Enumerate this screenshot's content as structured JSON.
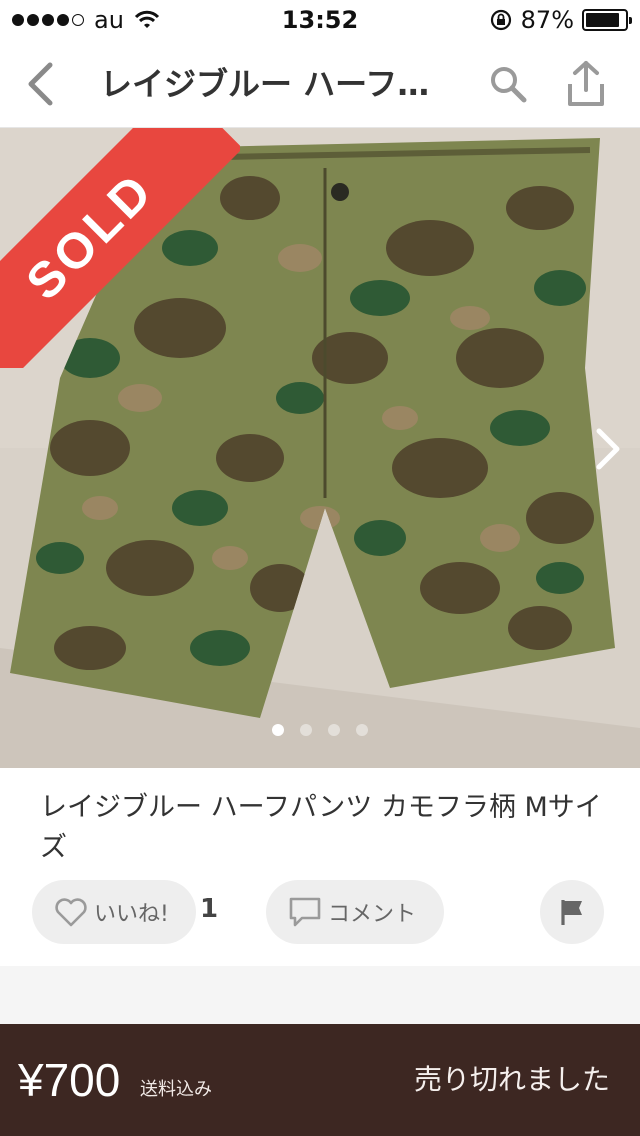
{
  "status_bar": {
    "carrier": "au",
    "time": "13:52",
    "battery_percent": "87%",
    "battery_level": 0.87
  },
  "nav": {
    "title": "レイジブルー ハーフ…",
    "back_icon": "chevron-left-icon",
    "search_icon": "search-icon",
    "share_icon": "share-icon"
  },
  "photo": {
    "sold_label": "SOLD",
    "page_count": 4,
    "current_page": 1
  },
  "item": {
    "title": "レイジブルー ハーフパンツ カモフラ柄 Mサイズ",
    "like_label": "いいね!",
    "like_count": "1",
    "comment_label": "コメント"
  },
  "purchase": {
    "price": "¥700",
    "shipping": "送料込み",
    "status": "売り切れました"
  },
  "colors": {
    "sold_ribbon": "#e8473f",
    "bottom_bar": "#3d2722"
  }
}
